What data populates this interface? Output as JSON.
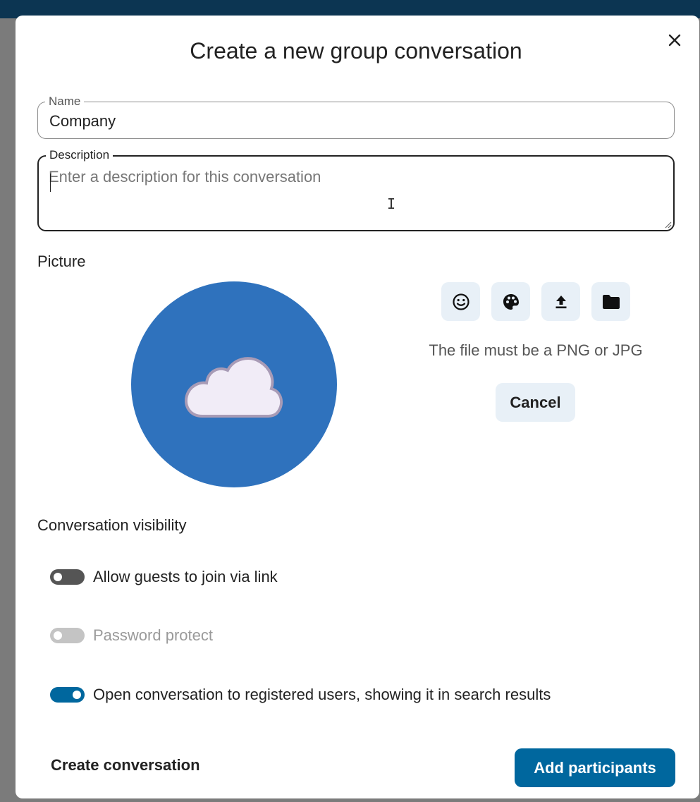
{
  "dialog": {
    "title": "Create a new group conversation",
    "close_icon": "close-icon"
  },
  "name_field": {
    "label": "Name",
    "value": "Company"
  },
  "description_field": {
    "label": "Description",
    "placeholder": "Enter a description for this conversation",
    "value": ""
  },
  "picture": {
    "label": "Picture",
    "avatar_color": "#2f72bd",
    "avatar_icon": "cloud-icon",
    "buttons": [
      {
        "name": "emoji-icon"
      },
      {
        "name": "palette-icon"
      },
      {
        "name": "upload-icon"
      },
      {
        "name": "folder-icon"
      }
    ],
    "hint": "The file must be a PNG or JPG",
    "cancel_label": "Cancel"
  },
  "visibility": {
    "label": "Conversation visibility",
    "toggles": [
      {
        "label": "Allow guests to join via link",
        "state": "off"
      },
      {
        "label": "Password protect",
        "state": "disabled"
      },
      {
        "label": "Open conversation to registered users, showing it in search results",
        "state": "on"
      }
    ]
  },
  "footer": {
    "create_label": "Create conversation",
    "add_label": "Add participants"
  },
  "colors": {
    "primary": "#00679e",
    "secondary_bg": "#e8f0f7",
    "top_bar": "#0c3552"
  }
}
